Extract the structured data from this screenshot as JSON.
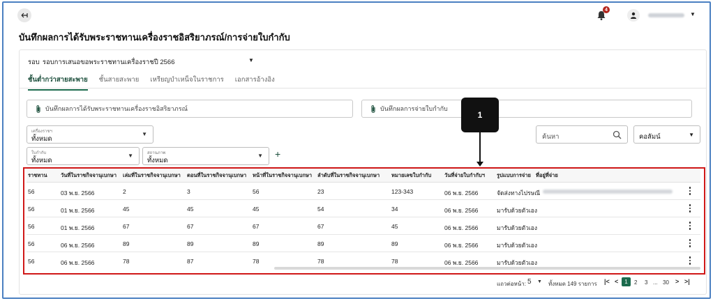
{
  "header": {
    "notifications_count": "4",
    "icons": [
      "back-arrow-icon",
      "bell-icon",
      "user-icon",
      "chevron-down-icon"
    ]
  },
  "page": {
    "title": "บันทึกผลการได้รับพระราชทานเครื่องราชอิสริยาภรณ์/การจ่ายใบกำกับ"
  },
  "round_select": {
    "label": "รอบ",
    "value": "รอบการเสนอขอพระราชทานเครื่องราชปี 2566"
  },
  "tabs": [
    {
      "label": "ชั้นต่ำกว่าสายสะพาย",
      "active": true
    },
    {
      "label": "ชั้นสายสะพาย",
      "active": false
    },
    {
      "label": "เหรียญบำเหน็จในราชการ",
      "active": false
    },
    {
      "label": "เอกสารอ้างอิง",
      "active": false
    }
  ],
  "attachments": [
    {
      "label": "บันทึกผลการได้รับพระราชทานเครื่องราชอิสริยาภรณ์"
    },
    {
      "label": "บันทึกผลการจ่ายใบกำกับ"
    }
  ],
  "filters": {
    "decoration": {
      "label": "เครื่องราชฯ",
      "value": "ทั้งหมด"
    },
    "certificate": {
      "label": "ใบกำกับ",
      "value": "ทั้งหมด"
    },
    "status": {
      "label": "สถานภาพ",
      "value": "ทั้งหมด"
    },
    "search_placeholder": "ค้นหา",
    "columns_label": "คอลัมน์"
  },
  "table": {
    "headers": [
      "ราชทาน",
      "วันที่ในราชกิจจานุเบกษา",
      "เล่มที่ในราชกิจจานุเบกษา",
      "ตอนที่ในราชกิจจานุเบกษา",
      "หน้าที่ในราชกิจจานุเบกษา",
      "ลำดับที่ในราชกิจจานุเบกษา",
      "หมายเลขใบกำกับ",
      "วันที่จ่ายใบกำกับฯ",
      "รูปแบบการจ่าย",
      "ที่อยู่ที่จ่าย"
    ],
    "rows": [
      [
        "56",
        "03 พ.ย. 2566",
        "2",
        "3",
        "56",
        "23",
        "123-343",
        "06 พ.ย. 2566",
        "จัดส่งทางไปรษณี"
      ],
      [
        "56",
        "01 พ.ย. 2566",
        "45",
        "45",
        "45",
        "54",
        "34",
        "06 พ.ย. 2566",
        "มารับด้วยตัวเอง"
      ],
      [
        "56",
        "01 พ.ย. 2566",
        "67",
        "67",
        "67",
        "67",
        "45",
        "06 พ.ย. 2566",
        "มารับด้วยตัวเอง"
      ],
      [
        "56",
        "06 พ.ย. 2566",
        "89",
        "89",
        "89",
        "89",
        "89",
        "06 พ.ย. 2566",
        "มารับด้วยตัวเอง"
      ],
      [
        "56",
        "06 พ.ย. 2566",
        "78",
        "87",
        "78",
        "78",
        "78",
        "06 พ.ย. 2566",
        "มารับด้วยตัวเอง"
      ]
    ]
  },
  "pagination": {
    "rows_per_page_label": "แถวต่อหน้า:",
    "rows_per_page": "5",
    "total": "ทั้งหมด 149 รายการ",
    "pages": [
      "1",
      "2",
      "3",
      "...",
      "30"
    ],
    "first": "|<",
    "prev": "<",
    "next": ">",
    "last": ">|"
  },
  "annotation": {
    "callout": "1",
    "highlight_color": "#d01818"
  }
}
